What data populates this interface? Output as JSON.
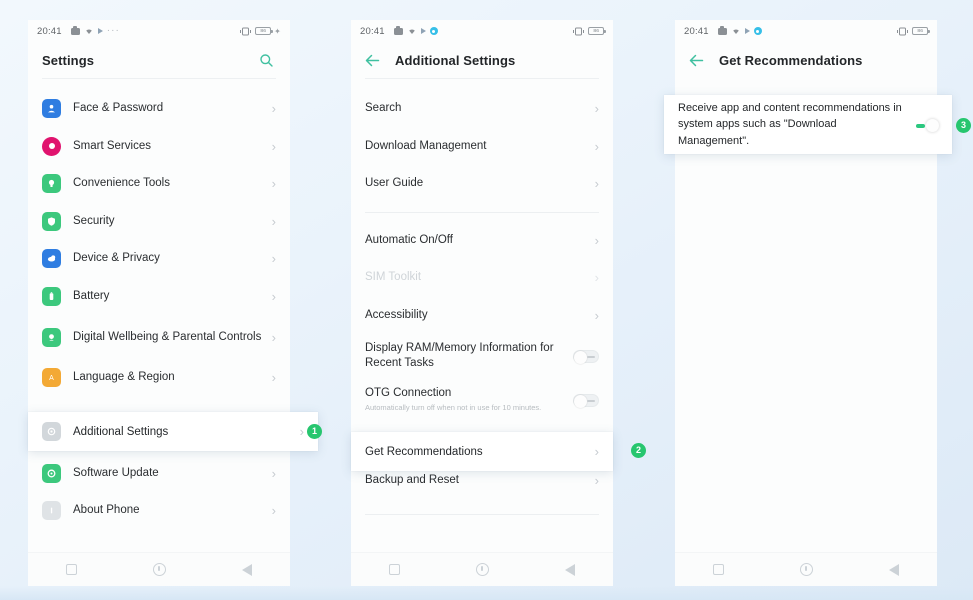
{
  "badges": {
    "one": "1",
    "two": "2",
    "three": "3"
  },
  "status_bar": {
    "time": "20:41",
    "icons_left": [
      "camera-icon",
      "wifi-icon",
      "play-icon",
      "more-dots-icon"
    ],
    "icons_right": [
      "vibrate-icon",
      "battery-icon",
      "charge-dot-icon"
    ],
    "battery_text": "86"
  },
  "colors": {
    "accent_green": "#27c66f",
    "teal": "#3fc0a0",
    "page_bg": "#e7f0f9"
  },
  "phone1": {
    "title": "Settings",
    "search_icon": "search-icon",
    "items": [
      {
        "label": "Face & Password",
        "icon_color": "#2f7de1",
        "glyph": "person"
      },
      {
        "label": "Smart Services",
        "icon_color": "#e0136e",
        "glyph": "dot"
      },
      {
        "label": "Convenience Tools",
        "icon_color": "#3cc87d",
        "glyph": "bulb"
      },
      {
        "label": "Security",
        "icon_color": "#3cc87d",
        "glyph": "shield"
      },
      {
        "label": "Device & Privacy",
        "icon_color": "#2f7de1",
        "glyph": "cloud"
      },
      {
        "label": "Battery",
        "icon_color": "#3cc87d",
        "glyph": "battery"
      },
      {
        "label": "Digital Wellbeing & Parental Controls",
        "icon_color": "#3cc87d",
        "glyph": "clock"
      },
      {
        "label": "Language & Region",
        "icon_color": "#f3a935",
        "glyph": "letter"
      }
    ],
    "highlight_item": {
      "label": "Additional Settings",
      "icon_color": "#cfd4d8",
      "glyph": "gear"
    },
    "items_after": [
      {
        "label": "Software Update",
        "icon_color": "#3cc87d",
        "glyph": "refresh"
      },
      {
        "label": "About Phone",
        "icon_color": "#d5dade",
        "glyph": "info"
      }
    ]
  },
  "phone2": {
    "title": "Additional Settings",
    "back_icon": "back-arrow-icon",
    "group1": [
      {
        "label": "Search"
      },
      {
        "label": "Download Management"
      },
      {
        "label": "User Guide"
      }
    ],
    "group2": [
      {
        "label": "Automatic On/Off",
        "disabled": false,
        "type": "chevron"
      },
      {
        "label": "SIM Toolkit",
        "disabled": true,
        "type": "chevron"
      },
      {
        "label": "Accessibility",
        "disabled": false,
        "type": "chevron"
      },
      {
        "label": "Display RAM/Memory Information for Recent Tasks",
        "disabled": false,
        "type": "toggle",
        "toggle_on": false
      },
      {
        "label": "OTG Connection",
        "sub": "Automatically turn off when not in use for 10 minutes.",
        "disabled": false,
        "type": "toggle",
        "toggle_on": false
      }
    ],
    "highlight_item": {
      "label": "Get Recommendations"
    },
    "items_after": [
      {
        "label": "Backup and Reset"
      }
    ]
  },
  "phone3": {
    "title": "Get Recommendations",
    "back_icon": "back-arrow-icon",
    "description": "Receive app and content recommendations in system apps such as \"Download Management\".",
    "toggle_on": true
  },
  "navbar": {
    "recents_icon": "square-recents-icon",
    "home_icon": "circle-home-icon",
    "back_icon": "triangle-back-icon"
  }
}
